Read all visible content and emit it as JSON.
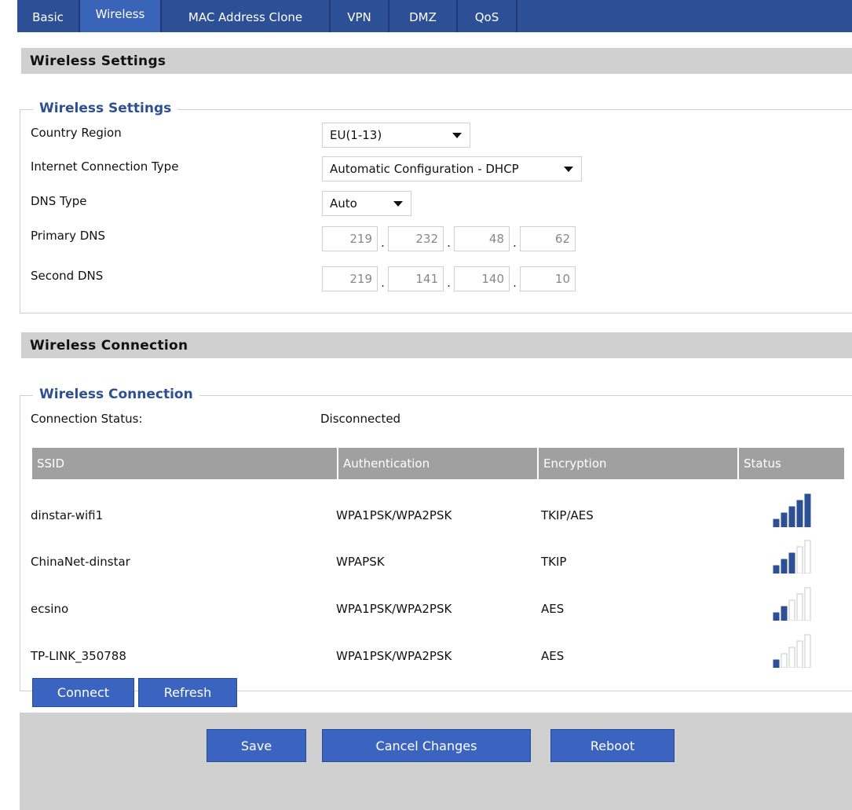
{
  "tabs": [
    {
      "label": "Basic",
      "active": false
    },
    {
      "label": "Wireless",
      "active": true
    },
    {
      "label": "MAC Address Clone",
      "active": false
    },
    {
      "label": "VPN",
      "active": false
    },
    {
      "label": "DMZ",
      "active": false
    },
    {
      "label": "QoS",
      "active": false
    }
  ],
  "wireless_settings": {
    "header": "Wireless Settings",
    "legend": "Wireless Settings",
    "country_region": {
      "label": "Country Region",
      "value": "EU(1-13)"
    },
    "connection_type": {
      "label": "Internet Connection Type",
      "value": "Automatic Configuration - DHCP"
    },
    "dns_type": {
      "label": "DNS Type",
      "value": "Auto"
    },
    "primary_dns": {
      "label": "Primary DNS",
      "octets": [
        "219",
        "232",
        "48",
        "62"
      ]
    },
    "second_dns": {
      "label": "Second DNS",
      "octets": [
        "219",
        "141",
        "140",
        "10"
      ]
    }
  },
  "wireless_connection": {
    "header": "Wireless Connection",
    "legend": "Wireless Connection",
    "status_label": "Connection Status:",
    "status_value": "Disconnected",
    "columns": [
      "SSID",
      "Authentication",
      "Encryption",
      "Status"
    ],
    "networks": [
      {
        "ssid": "dinstar-wifi1",
        "auth": "WPA1PSK/WPA2PSK",
        "enc": "TKIP/AES",
        "signal_bars": 5
      },
      {
        "ssid": "ChinaNet-dinstar",
        "auth": "WPAPSK",
        "enc": "TKIP",
        "signal_bars": 3
      },
      {
        "ssid": "ecsino",
        "auth": "WPA1PSK/WPA2PSK",
        "enc": "AES",
        "signal_bars": 2
      },
      {
        "ssid": "TP-LINK_350788",
        "auth": "WPA1PSK/WPA2PSK",
        "enc": "AES",
        "signal_bars": 1
      }
    ],
    "connect_label": "Connect",
    "refresh_label": "Refresh"
  },
  "footer": {
    "save_label": "Save",
    "cancel_label": "Cancel Changes",
    "reboot_label": "Reboot"
  },
  "colors": {
    "tab_bar": "#2c4f96",
    "accent": "#3a64c0",
    "signal_on": "#2c4f96",
    "signal_off": "#ffffff"
  }
}
